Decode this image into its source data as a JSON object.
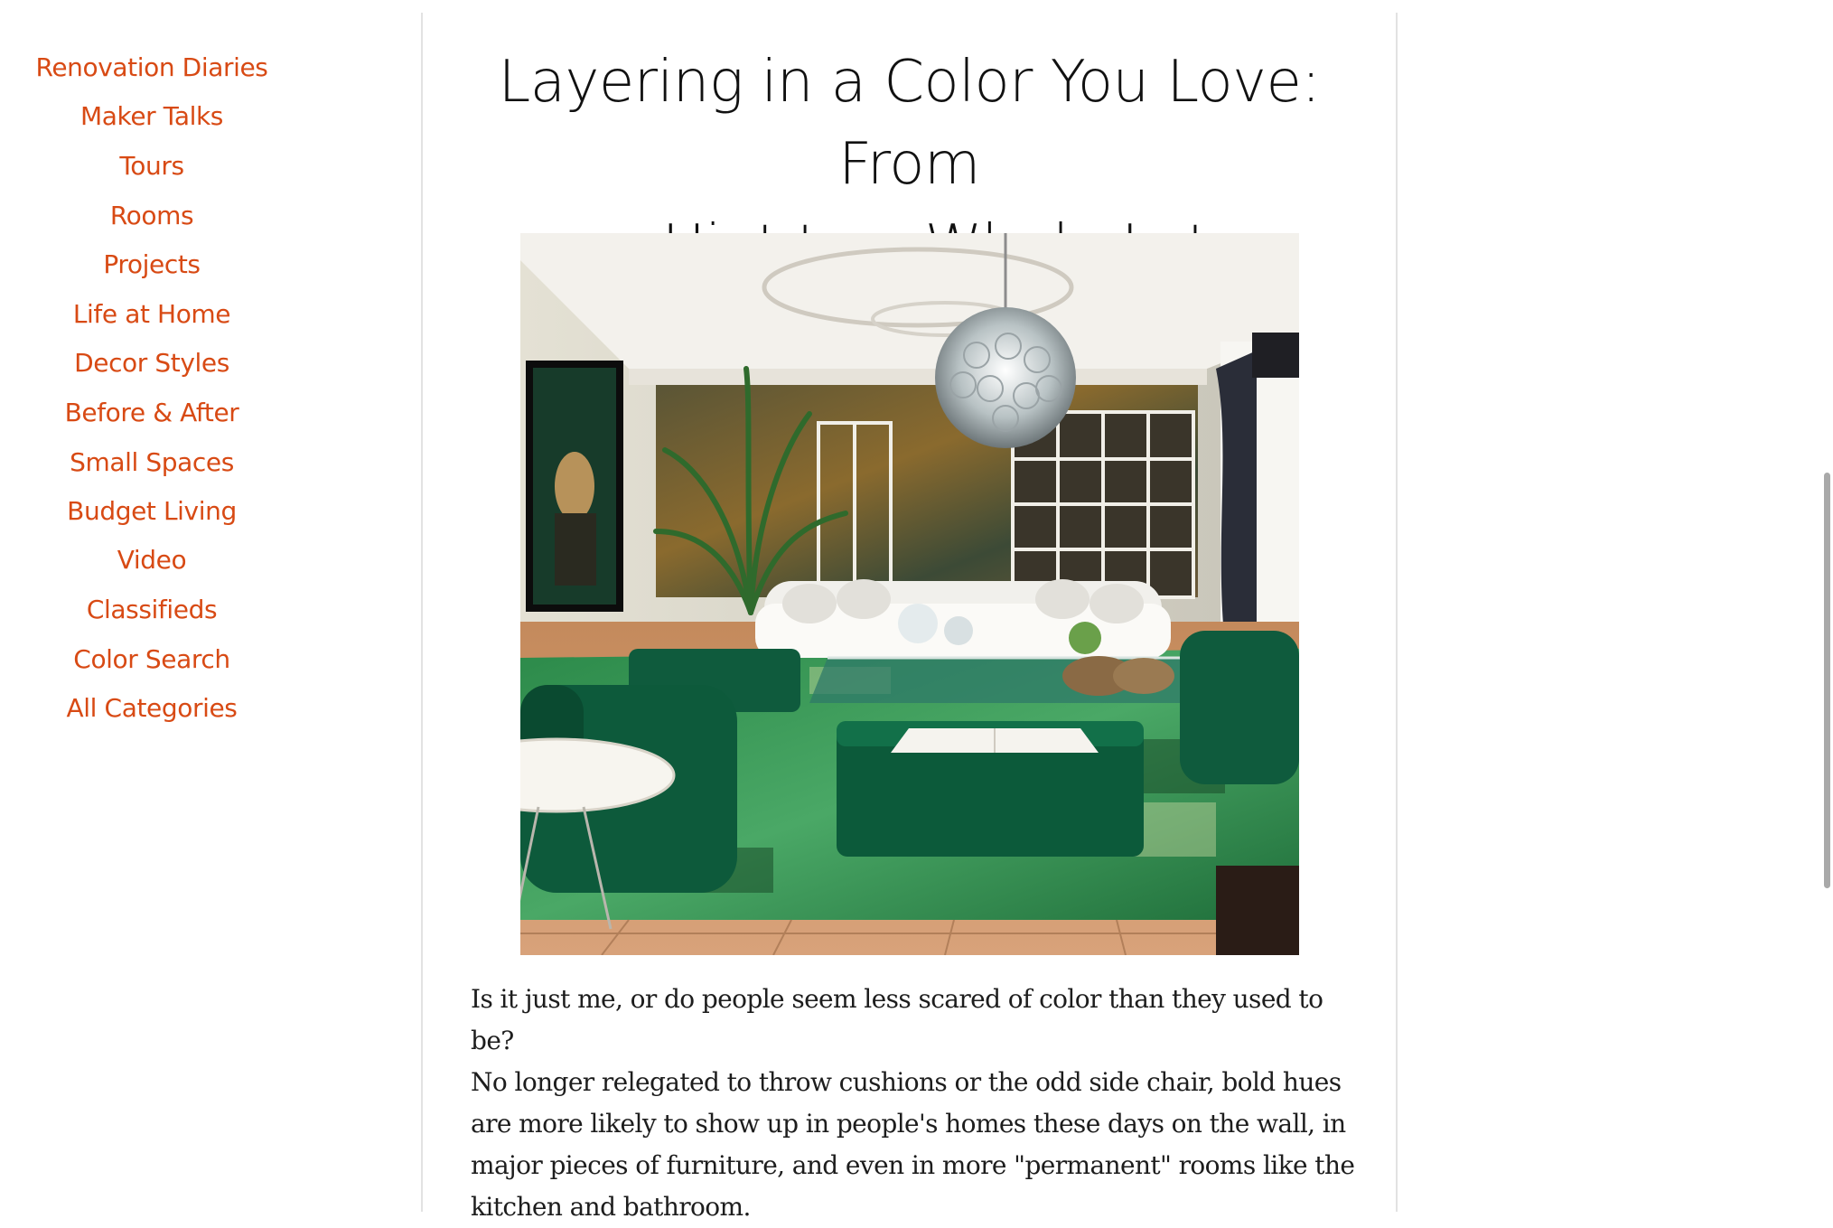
{
  "sidebar": {
    "items": [
      {
        "label": "Renovation Diaries"
      },
      {
        "label": "Maker Talks"
      },
      {
        "label": "Tours"
      },
      {
        "label": "Rooms"
      },
      {
        "label": "Projects"
      },
      {
        "label": "Life at Home"
      },
      {
        "label": "Decor Styles"
      },
      {
        "label": "Before & After"
      },
      {
        "label": "Small Spaces"
      },
      {
        "label": "Budget Living"
      },
      {
        "label": "Video"
      },
      {
        "label": "Classifieds"
      },
      {
        "label": "Color Search"
      },
      {
        "label": "All Categories"
      }
    ]
  },
  "article": {
    "title_line1": "Layering in a Color You Love: From",
    "title_line2": "a Hint to a Whole Lot",
    "body_line1": "Is it just me, or do people seem less scared of color than they used to be?",
    "body_line2": "No longer relegated to throw cushions or the odd side chair, bold hues",
    "body_line3": "are more likely to show up in people's homes these days on the wall, in",
    "body_line4": "major pieces of furniture, and even in more \"permanent\" rooms like the",
    "body_line5": "kitchen and bathroom."
  },
  "colors": {
    "link": "#d84a14",
    "divider": "#e2e2e2",
    "text": "#1d1d1d"
  }
}
